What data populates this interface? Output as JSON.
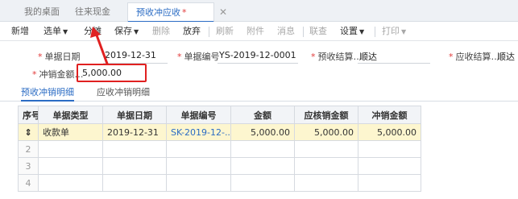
{
  "tabs": [
    {
      "label": "我的桌面",
      "active": false
    },
    {
      "label": "往来现金",
      "active": false
    },
    {
      "label": "预收冲应收",
      "active": true,
      "modified_marker": "*",
      "close": "✕"
    }
  ],
  "toolbar": {
    "new": "新增",
    "select_doc": "选单",
    "split": "分摊",
    "save": "保存",
    "delete": "删除",
    "abandon": "放弃",
    "refresh": "刷新",
    "attachment": "附件",
    "message": "消息",
    "check": "联查",
    "settings": "设置",
    "print": "打印"
  },
  "form": {
    "doc_date_label": "单据日期",
    "doc_date_value": "2019-12-31",
    "doc_no_label": "单据编号",
    "doc_no_value": "YS-2019-12-0001",
    "prepaid_settle_label": "预收结算…",
    "prepaid_settle_value": "顺达",
    "receivable_settle_label": "应收结算…",
    "receivable_settle_value": "顺达",
    "writeoff_amount_label": "冲销金额…",
    "writeoff_amount_value": "5,000.00"
  },
  "subtabs": [
    {
      "label": "预收冲销明细",
      "active": true
    },
    {
      "label": "应收冲销明细",
      "active": false
    }
  ],
  "grid": {
    "columns": [
      "序号",
      "单据类型",
      "单据日期",
      "单据编号",
      "金额",
      "应核销金额",
      "冲销金额"
    ],
    "rows": [
      {
        "index_icon": "⇕",
        "type": "收款单",
        "date": "2019-12-31",
        "doc_no": "SK-2019-12-...",
        "amount": "5,000.00",
        "due_amount": "5,000.00",
        "writeoff": "5,000.00"
      }
    ],
    "empty_row_numbers": [
      "2",
      "3",
      "4"
    ]
  }
}
